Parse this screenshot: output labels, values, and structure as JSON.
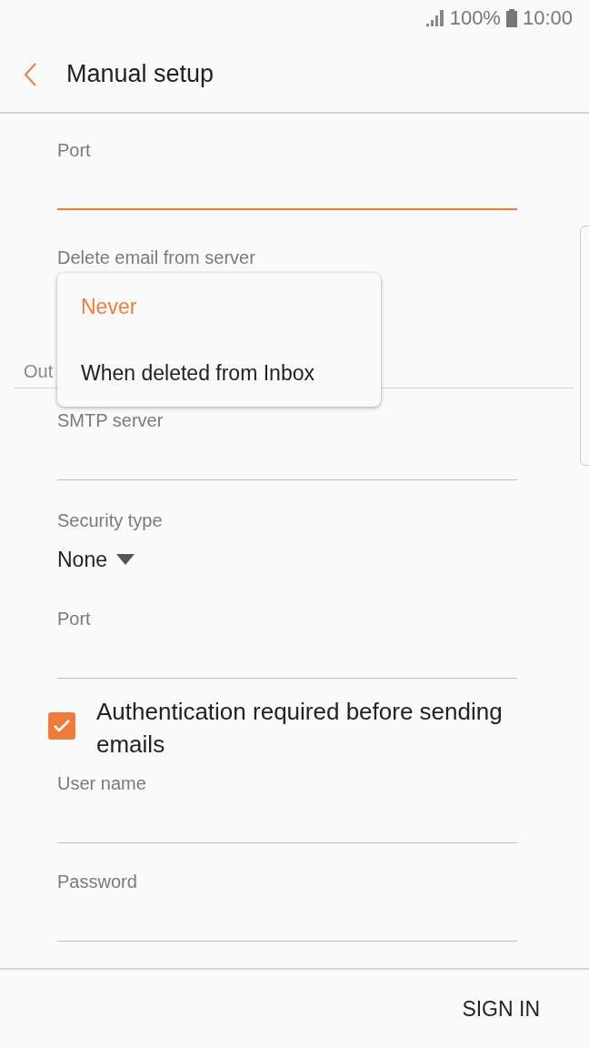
{
  "status_bar": {
    "battery": "100%",
    "time": "10:00"
  },
  "header": {
    "title": "Manual setup"
  },
  "incoming": {
    "fields": [
      {
        "kind": "text",
        "label": "Port",
        "focused": true
      },
      {
        "kind": "dropdown",
        "label": "Delete email from server"
      }
    ]
  },
  "menu": {
    "options": [
      {
        "label": "Never",
        "selected": true
      },
      {
        "label": "When deleted from Inbox",
        "selected": false
      }
    ]
  },
  "outgoing": {
    "section_title": "Out",
    "fields": [
      {
        "kind": "text",
        "label": "SMTP server",
        "focused": false
      },
      {
        "kind": "dropdown",
        "label": "Security type",
        "value": "None"
      },
      {
        "kind": "text",
        "label": "Port",
        "focused": false
      },
      {
        "kind": "checkbox",
        "label": "Authentication required before sending emails",
        "checked": true
      },
      {
        "kind": "text",
        "label": "User name",
        "focused": false
      },
      {
        "kind": "text",
        "label": "Password",
        "focused": false
      }
    ]
  },
  "footer": {
    "button": "SIGN IN"
  }
}
